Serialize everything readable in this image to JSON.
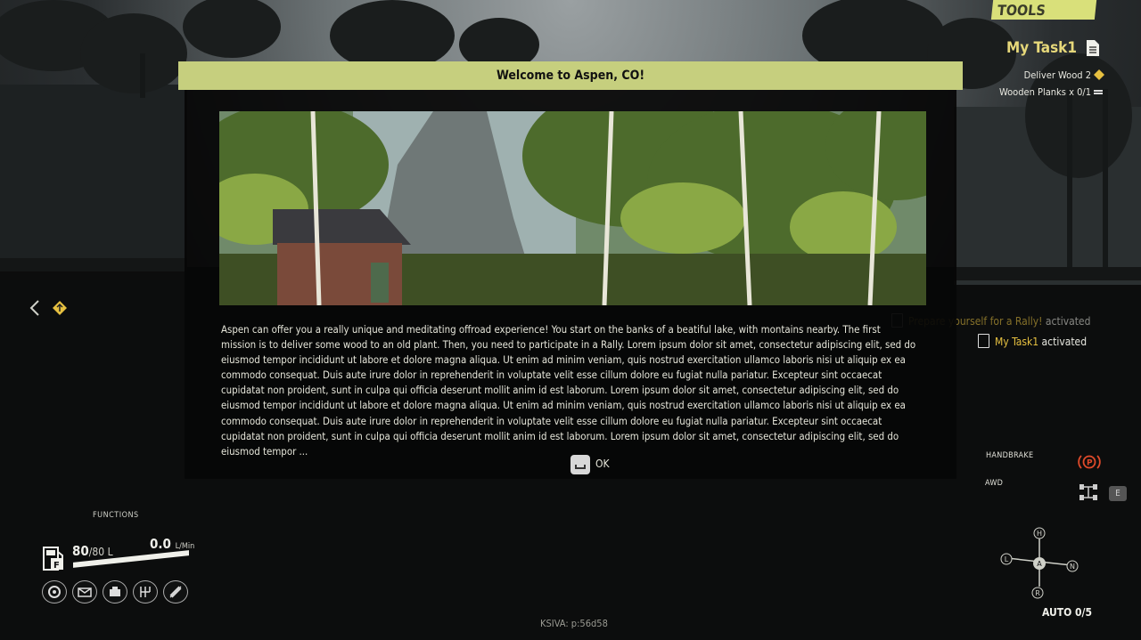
{
  "tools_tab": "TOOLS",
  "task_panel": {
    "title": "My Task1",
    "objectives": [
      {
        "text": "Deliver Wood 2"
      },
      {
        "text": "Wooden Planks x 0/1"
      }
    ]
  },
  "notifications": [
    {
      "highlight": "Prepare yourself for a Rally!",
      "suffix": "activated"
    },
    {
      "highlight": "My Task1",
      "suffix": "activated"
    }
  ],
  "dialog": {
    "title": "Welcome to Aspen, CO!",
    "body": "Aspen can offer you a really unique and meditating offroad experience! You start on the banks of a beatiful lake, with montains nearby. The first mission is to deliver some wood to an old plant. Then, you need to participate in a Rally. Lorem ipsum dolor sit amet, consectetur adipiscing elit, sed do eiusmod tempor incididunt ut labore et dolore magna aliqua. Ut enim ad minim veniam, quis nostrud exercitation ullamco laboris nisi ut aliquip ex ea commodo consequat. Duis aute irure dolor in reprehenderit in voluptate velit esse cillum dolore eu fugiat nulla pariatur. Excepteur sint occaecat cupidatat non proident, sunt in culpa qui officia deserunt mollit anim id est laborum. Lorem ipsum dolor sit amet, consectetur adipiscing elit, sed do eiusmod tempor incididunt ut labore et dolore magna aliqua. Ut enim ad minim veniam, quis nostrud exercitation ullamco laboris nisi ut aliquip ex ea commodo consequat. Duis aute irure dolor in reprehenderit in voluptate velit esse cillum dolore eu fugiat nulla pariatur. Excepteur sint occaecat cupidatat non proident, sunt in culpa qui officia deserunt mollit anim id est laborum. Lorem ipsum dolor sit amet, consectetur adipiscing elit, sed do eiusmod tempor ...",
    "ok_label": "OK"
  },
  "hud_left": {
    "functions_label": "FUNCTIONS",
    "fuel_current": "80",
    "fuel_max": "/80 L",
    "fuel_fraction": 1.0,
    "flow_value": "0.0",
    "flow_unit": "L/Min",
    "function_icons": [
      "tire-icon",
      "winch-icon",
      "engine-icon",
      "gearbox-icon",
      "suspension-icon"
    ]
  },
  "hud_right": {
    "handbrake_label": "HANDBRAKE",
    "awd_label": "AWD",
    "awd_key": "E",
    "gears": [
      "H",
      "L",
      "A",
      "N",
      "R"
    ],
    "active_gear": "A",
    "gear_mode": "AUTO 0/5"
  },
  "bottom_code": "KSIVA: p:56d58",
  "colors": {
    "accent_yellow": "#d9e07a",
    "banner": "#c6cf7e",
    "task_title": "#e6d87a",
    "highlight": "#e6c040",
    "handbrake_red": "#e04a2a"
  }
}
